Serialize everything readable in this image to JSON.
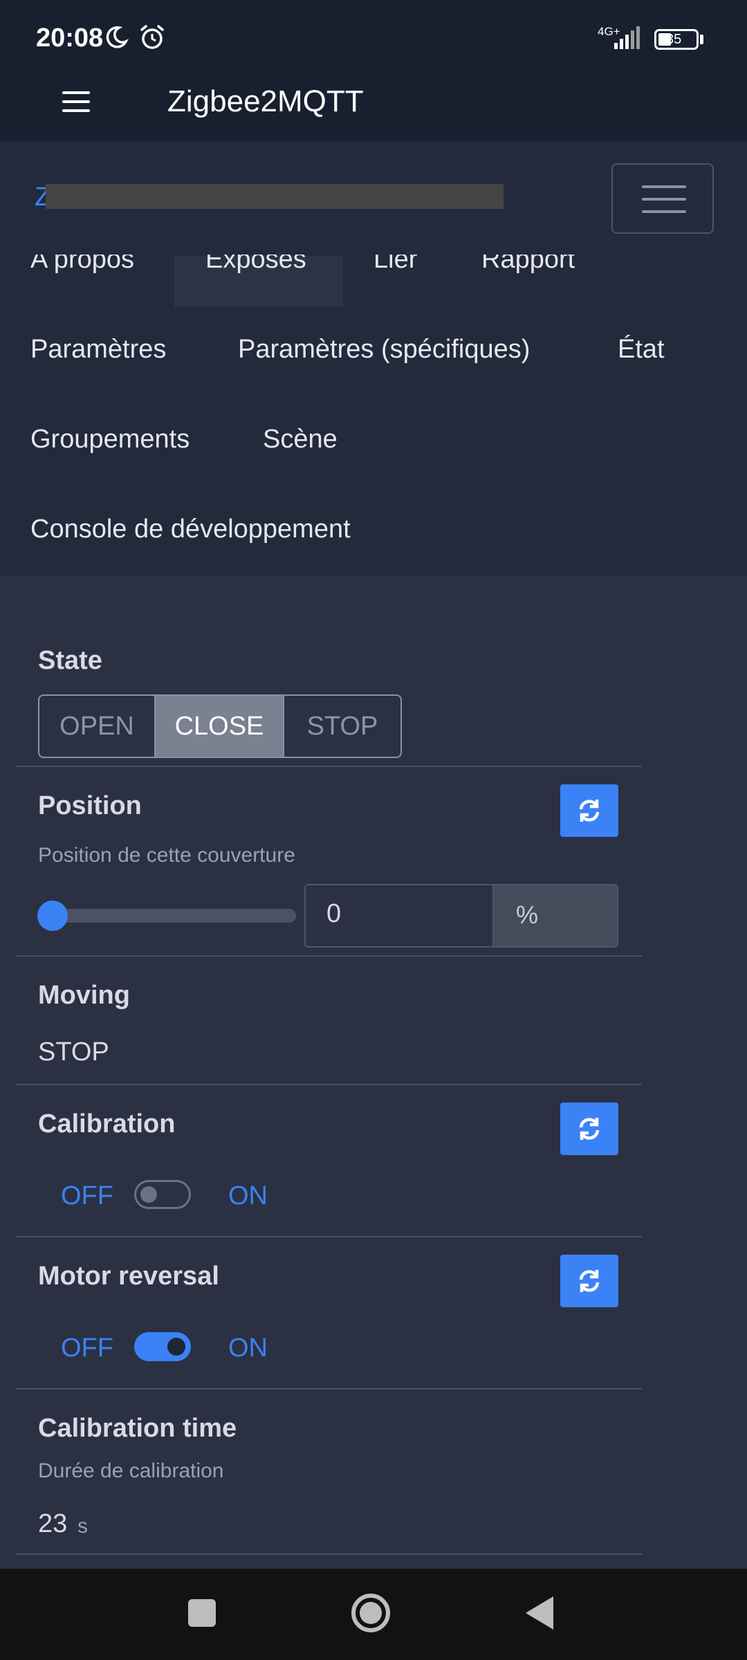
{
  "status_bar": {
    "time": "20:08",
    "network": "4G+",
    "battery": "35",
    "icons": [
      "moon-icon",
      "alarm-icon",
      "signal-icon",
      "battery-icon"
    ]
  },
  "app_bar": {
    "title": "Zigbee2MQTT",
    "menu_icon": "hamburger-icon"
  },
  "device_header": {
    "link_text": "Z"
  },
  "tabs": [
    {
      "label": "A propos"
    },
    {
      "label": "Exposes",
      "active": true
    },
    {
      "label": "Lier"
    },
    {
      "label": "Rapport"
    },
    {
      "label": "Paramètres"
    },
    {
      "label": "Paramètres (spécifiques)"
    },
    {
      "label": "État"
    },
    {
      "label": "Groupements"
    },
    {
      "label": "Scène"
    },
    {
      "label": "Console de développement"
    }
  ],
  "exposes": {
    "state": {
      "label": "State",
      "options": [
        "OPEN",
        "CLOSE",
        "STOP"
      ],
      "selected": "CLOSE"
    },
    "position": {
      "label": "Position",
      "description": "Position de cette couverture",
      "value": "0",
      "unit": "%",
      "slider_fraction": 0
    },
    "moving": {
      "label": "Moving",
      "value": "STOP"
    },
    "calibration": {
      "label": "Calibration",
      "off_label": "OFF",
      "on_label": "ON",
      "state": "off"
    },
    "motor_reversal": {
      "label": "Motor reversal",
      "off_label": "OFF",
      "on_label": "ON",
      "state": "on"
    },
    "calibration_time": {
      "label": "Calibration time",
      "description": "Durée de calibration",
      "value": "23",
      "unit": "s"
    }
  },
  "colors": {
    "accent": "#3b82f6",
    "background": "#2b3142",
    "header": "#182030",
    "nav_panel": "#222a3b"
  }
}
